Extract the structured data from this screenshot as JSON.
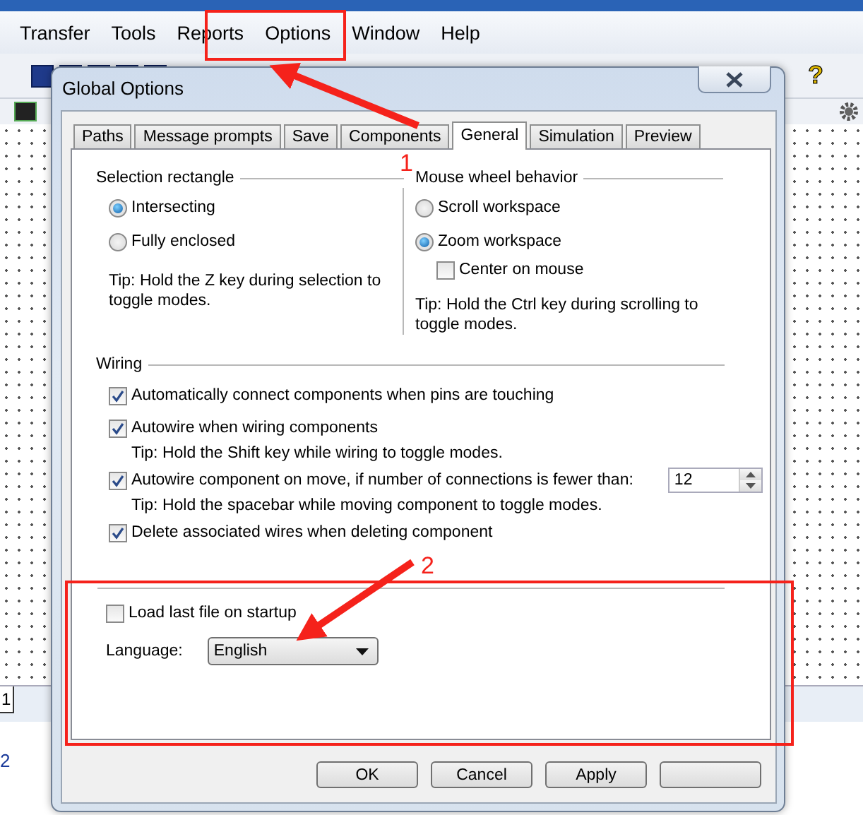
{
  "menu_bar": [
    {
      "label": "Transfer"
    },
    {
      "label": "Tools"
    },
    {
      "label": "Reports"
    },
    {
      "label": "Options"
    },
    {
      "label": "Window"
    },
    {
      "label": "Help"
    }
  ],
  "help_glyph": "?",
  "sheet_tab": "1",
  "side_text": "2",
  "dialog": {
    "title": "Global Options",
    "tabs": [
      {
        "label": "Paths",
        "selected": false
      },
      {
        "label": "Message prompts",
        "selected": false
      },
      {
        "label": "Save",
        "selected": false
      },
      {
        "label": "Components",
        "selected": false
      },
      {
        "label": "General",
        "selected": true
      },
      {
        "label": "Simulation",
        "selected": false
      },
      {
        "label": "Preview",
        "selected": false
      }
    ],
    "selection_rectangle": {
      "title": "Selection rectangle",
      "options": [
        {
          "label": "Intersecting",
          "selected": true
        },
        {
          "label": "Fully enclosed",
          "selected": false
        }
      ],
      "tip": "Tip: Hold the Z key during selection to toggle modes."
    },
    "mouse_wheel": {
      "title": "Mouse wheel behavior",
      "options": [
        {
          "label": "Scroll workspace",
          "selected": false
        },
        {
          "label": "Zoom workspace",
          "selected": true
        }
      ],
      "center_on_mouse": {
        "label": "Center on mouse",
        "checked": false
      },
      "tip": "Tip: Hold the Ctrl key during scrolling to toggle modes."
    },
    "wiring": {
      "title": "Wiring",
      "items": [
        {
          "label": "Automatically connect components when pins are touching",
          "checked": true
        },
        {
          "label": "Autowire when wiring components",
          "checked": true,
          "tip": "Tip: Hold the Shift key while wiring to toggle modes."
        },
        {
          "label": "Autowire component on move, if number of connections is fewer than:",
          "checked": true,
          "value": "12",
          "tip": "Tip: Hold the spacebar while moving component to toggle modes."
        },
        {
          "label": "Delete associated wires when deleting component",
          "checked": true
        }
      ]
    },
    "load_last_file": {
      "label": "Load last file on startup",
      "checked": false
    },
    "language": {
      "label": "Language:",
      "value": "English"
    },
    "buttons": [
      {
        "label": "OK"
      },
      {
        "label": "Cancel"
      },
      {
        "label": "Apply"
      }
    ]
  },
  "annotations": [
    {
      "label": "1"
    },
    {
      "label": "2"
    }
  ]
}
